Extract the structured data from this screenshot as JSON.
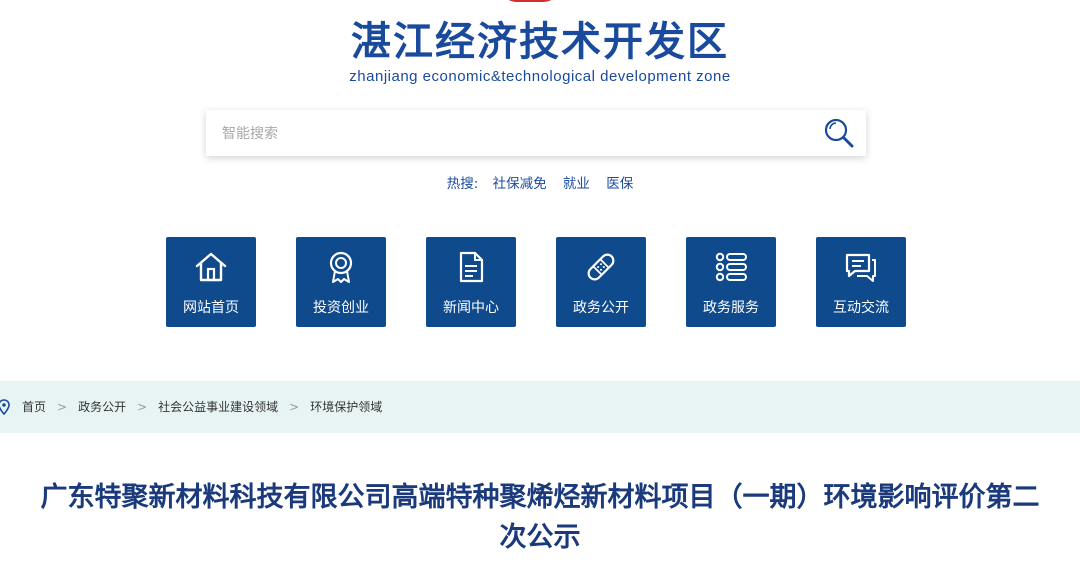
{
  "site": {
    "title": "湛江经济技术开发区",
    "subtitle": "zhanjiang economic&technological development zone"
  },
  "search": {
    "placeholder": "智能搜索"
  },
  "hot_search": {
    "label": "热搜:",
    "terms": [
      "社保减免",
      "就业",
      "医保"
    ]
  },
  "nav": [
    {
      "label": "网站首页",
      "icon": "home-icon"
    },
    {
      "label": "投资创业",
      "icon": "award-icon"
    },
    {
      "label": "新闻中心",
      "icon": "document-icon"
    },
    {
      "label": "政务公开",
      "icon": "bandage-icon"
    },
    {
      "label": "政务服务",
      "icon": "list-icon"
    },
    {
      "label": "互动交流",
      "icon": "chat-icon"
    }
  ],
  "breadcrumb": [
    "首页",
    "政务公开",
    "社会公益事业建设领域",
    "环境保护领域"
  ],
  "article": {
    "title_line1": "广东特聚新材料科技有限公司高端特种聚烯烃新材料项目（一期）环境影响评价第二",
    "title_line2": "次公示"
  },
  "colors": {
    "brand": "#1a4a9c",
    "nav_bg": "#0f4a8c",
    "breadcrumb_bg": "#e8f4f4"
  }
}
